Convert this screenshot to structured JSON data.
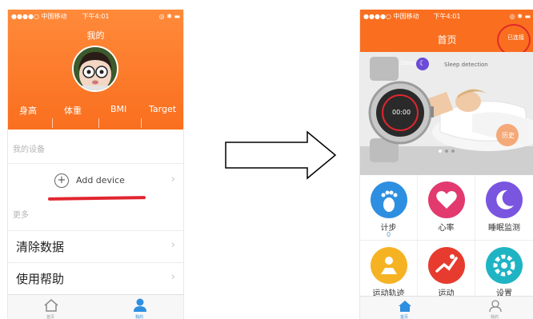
{
  "left": {
    "status": {
      "carrier": "●●●●○ 中国移动 ",
      "time": "下午4:01",
      "right": "◎ ✱ ▬"
    },
    "title": "我的",
    "metrics": [
      "身高",
      "体重",
      "BMI",
      "Target"
    ],
    "my_devices_label": "我的设备",
    "add_device_label": "Add device",
    "more_label": "更多",
    "menu": [
      "清除数据",
      "使用帮助"
    ],
    "tabs": [
      "首页",
      "我的"
    ]
  },
  "right": {
    "status": {
      "carrier": "●●●●○ 中国移动 ",
      "time": "下午4:01",
      "right": "◎ ✱ ▬"
    },
    "title": "首页",
    "connected": "已连接",
    "banner": {
      "sleep": "Sleep",
      "detection": "Sleep detection",
      "watch_time": "00:00",
      "button": "历史"
    },
    "grid": [
      {
        "label": "计步",
        "sub": "0"
      },
      {
        "label": "心率"
      },
      {
        "label": "睡眠监测"
      },
      {
        "label": "运动轨迹"
      },
      {
        "label": "运动"
      },
      {
        "label": "设置"
      }
    ],
    "tabs": [
      "首页",
      "我的"
    ]
  },
  "colors": {
    "orange": "#f96f1f",
    "red": "#e1262f",
    "blue": "#2e8fe0"
  }
}
